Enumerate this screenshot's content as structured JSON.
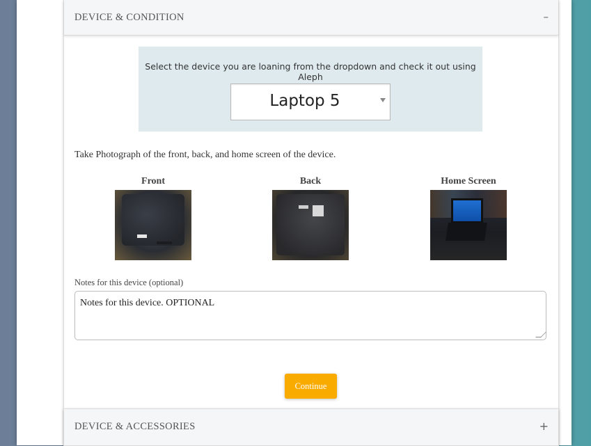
{
  "sections": {
    "device_condition": {
      "title": "DEVICE & CONDITION",
      "toggle": "–"
    },
    "device_accessories": {
      "title": "DEVICE & ACCESSORIES",
      "toggle": "+"
    }
  },
  "instruction_banner": {
    "text": "Select the device you are loaning from the dropdown and check it out using Aleph",
    "device_select": {
      "selected": "Laptop 5"
    }
  },
  "photos": {
    "instruction": "Take Photograph of the front, back, and home screen of the device.",
    "items": [
      {
        "label": "Front",
        "icon": "laptop-lid-photo"
      },
      {
        "label": "Back",
        "icon": "laptop-base-photo"
      },
      {
        "label": "Home Screen",
        "icon": "laptop-screen-photo"
      }
    ]
  },
  "notes": {
    "label": "Notes for this device (optional)",
    "value": "Notes for this device. OPTIONAL"
  },
  "actions": {
    "continue_label": "Continue"
  },
  "colors": {
    "accent_button": "#f9ab00",
    "banner_bg": "#dfeaef",
    "header_bg": "#f4f6f7"
  }
}
